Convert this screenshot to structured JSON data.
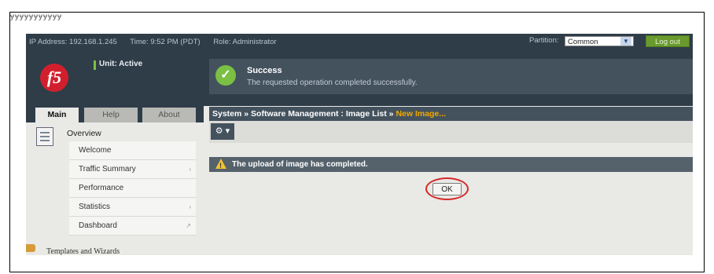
{
  "topbar": {
    "ip": "IP Address: 192.168.1.245",
    "time": "Time: 9:52 PM (PDT)",
    "role": "Role: Administrator",
    "partition_label": "Partition:",
    "partition_value": "Common",
    "logout": "Log out"
  },
  "header": {
    "unit_status": "Unit: Active",
    "logo_text": "f5",
    "success_title": "Success",
    "success_text": "The requested operation completed successfully."
  },
  "tabs": [
    "Main",
    "Help",
    "About"
  ],
  "nav": {
    "section_title": "Overview",
    "items": [
      {
        "label": "Welcome",
        "chevron": ""
      },
      {
        "label": "Traffic Summary",
        "chevron": "›"
      },
      {
        "label": "Performance",
        "chevron": ""
      },
      {
        "label": "Statistics",
        "chevron": "›"
      },
      {
        "label": "Dashboard",
        "chevron": "↗"
      }
    ],
    "next_section": "Templates and Wizards"
  },
  "breadcrumb": {
    "part1": "System",
    "sep1": " » ",
    "part2": "Software Management : Image List",
    "sep2": " » ",
    "part3": "New Image..."
  },
  "toolbar": {
    "gear": "⚙ ▾"
  },
  "warning": {
    "text": "The upload of image has completed."
  },
  "ok_button": "OK",
  "colors": {
    "accent": "#d21f2d",
    "success": "#7bc043",
    "highlight_ring": "#d62828",
    "crumb_new": "#f0a800"
  }
}
